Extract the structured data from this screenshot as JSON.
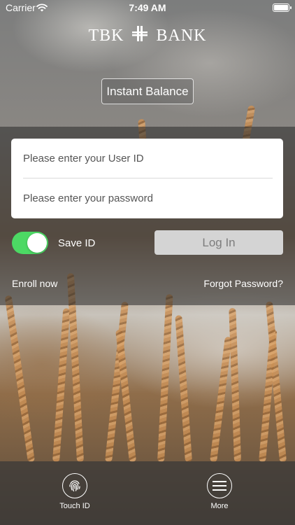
{
  "status_bar": {
    "carrier": "Carrier",
    "time": "7:49 AM"
  },
  "brand": {
    "left": "TBK",
    "right": "BANK"
  },
  "instant_balance": {
    "label": "Instant Balance"
  },
  "login_form": {
    "user_id_placeholder": "Please enter your User ID",
    "password_placeholder": "Please enter your password",
    "save_id_label": "Save ID",
    "save_id_on": true,
    "login_label": "Log In"
  },
  "links": {
    "enroll": "Enroll now",
    "forgot": "Forgot Password?"
  },
  "bottom_nav": [
    {
      "label": "Touch ID",
      "icon": "fingerprint-icon"
    },
    {
      "label": "More",
      "icon": "menu-icon"
    }
  ],
  "colors": {
    "toggle_on": "#4cd964",
    "login_bg": "#d4d4d4",
    "login_text": "#7d7d7d"
  }
}
